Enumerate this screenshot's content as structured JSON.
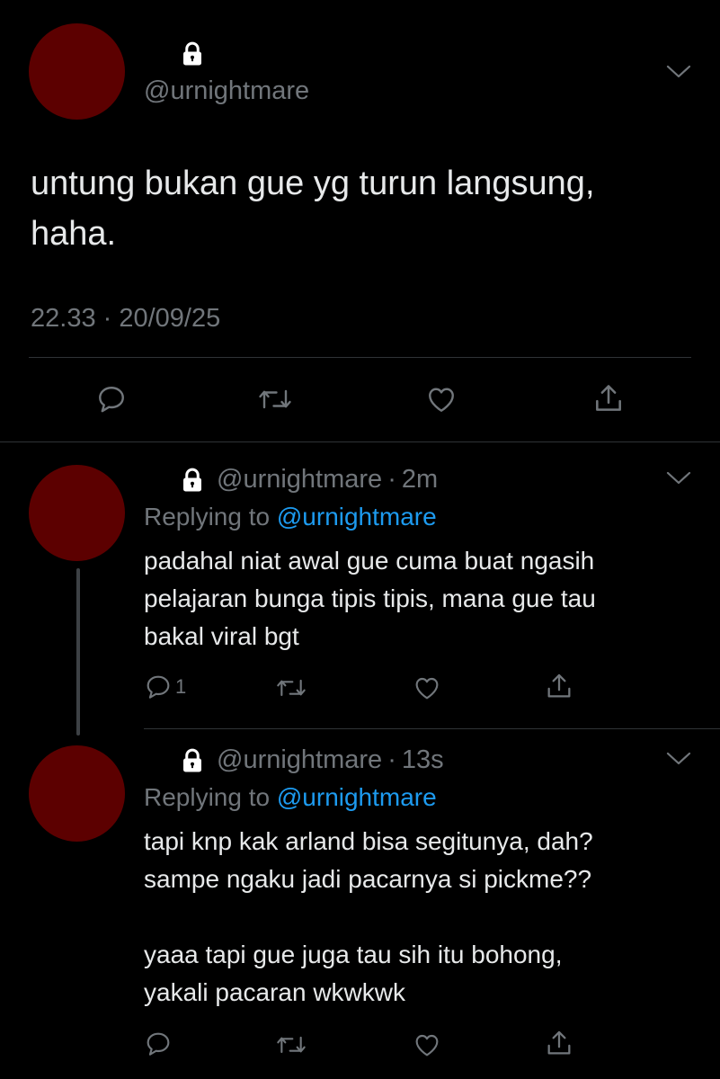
{
  "theme": {
    "background": "#000000",
    "text": "#e7e9ea",
    "muted": "#71767b",
    "link": "#1d9bf0",
    "avatar": "#5c0000",
    "divider": "#2f3336"
  },
  "main_tweet": {
    "handle": "@urnightmare",
    "text": "untung bukan gue yg turun langsung,\nhaha.",
    "timestamp": "22.33 · 20/09/25",
    "lock_icon": "lock-icon",
    "actions": [
      "reply-icon",
      "retweet-icon",
      "like-icon",
      "share-icon"
    ]
  },
  "replies": [
    {
      "handle": "@urnightmare",
      "separator": "·",
      "time": "2m",
      "replying_prefix": "Replying to",
      "replying_to": "@urnightmare",
      "text": "padahal niat awal gue cuma buat ngasih\npelajaran bunga tipis tipis, mana gue tau\nbakal viral bgt",
      "reply_count": "1"
    },
    {
      "handle": "@urnightmare",
      "separator": "·",
      "time": "13s",
      "replying_prefix": "Replying to",
      "replying_to": "@urnightmare",
      "text": "tapi knp kak arland bisa segitunya, dah?\nsampe ngaku jadi pacarnya si pickme??\n\nyaaa tapi gue juga tau sih itu bohong,\nyakali pacaran wkwkwk",
      "reply_count": ""
    }
  ]
}
